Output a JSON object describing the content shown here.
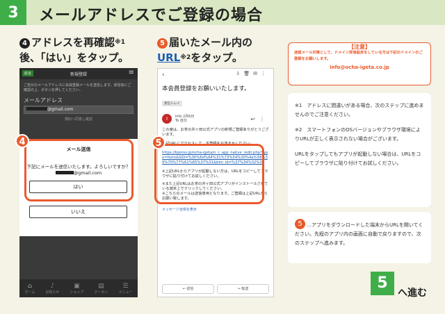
{
  "header": {
    "step": "3",
    "title": "メールアドレスでご登録の場合"
  },
  "step4": {
    "num": "4",
    "line1": "アドレスを再確認",
    "sup": "※1",
    "line2": "後、「はい」をタップ。"
  },
  "step5": {
    "num": "5",
    "line1": "届いたメール内の",
    "link": "URL",
    "sup": "※2",
    "line2": "をタップ。"
  },
  "phone1": {
    "back": "戻る",
    "title": "新規登録",
    "desc": "ご自分のメールアドレスに会員登録メールを送信します。受信後にご確認の上、ボタンを押してください。",
    "email_label": "メールアドレス",
    "email_value": "@gmail.com",
    "confirm": "規約へ同意し確認",
    "dialog": {
      "title": "メール送信",
      "msg1": "下記にメールを送信いたします。よろしいですか？",
      "msg2": "@gmail.com",
      "yes": "はい",
      "no": "いいえ"
    },
    "nav": [
      "ホーム",
      "お知らせ",
      "ショップ",
      "クーポン",
      "メニュー"
    ]
  },
  "phone2": {
    "subject": "本会員登録をお願いいたします。",
    "tag": "受信トレイ",
    "sender": "info",
    "date": "2月6日",
    "to": "To 自分",
    "body1": "この度は、お茶の井ヶ田公式アプリの新規ご登録ありがとうございます。",
    "body2": "下記URLにアクセスして、本登録をお済ませください。",
    "url": "https://bjenss.jp/ocha-igeta/n_c_app_native_redir.php?type=form&SID=%30%6d%64%31%73%54%30%4a%58%39%70%77%61%65%37%31&bim_id=%37%34%32%37",
    "body3": "※上記URLからアプリが起動しない方は、URLをコピーしてブラウザに貼り付けてお試しください。",
    "body4": "※また上記URLはお茶の井ヶ田公式アプリがインストールされている端末上でクリックしてください。",
    "body5": "※こちらのメールは送信専用となります。ご登録は上記URLからお願い致します。",
    "show_all": "メッセージ全体を表示",
    "reply": "返信",
    "forward": "転送"
  },
  "notice": {
    "title": "【注意】",
    "text": "迷惑メール対策として、ドメイン受信設定をしている方は下記のドメインのご登録をお願いします。",
    "mail": "info@ocha-igeta.co.jp"
  },
  "notes": {
    "n1": "※1　アドレスに間違いがある場合、次のステップに進めませんのでご注意ください。",
    "n2": "※2　スマートフォンのOSバージョンやブラウザ環境によりURLが正しく表示されない場合がございます。",
    "n3": "URLをタップしてもアプリが起動しない場合は、URLをコピーしてブラウザに貼り付けてお試しください。"
  },
  "note3": {
    "num": "5",
    "text": "…アプリをダウンロードした端末からURLを開いてください。先程のアプリ内の画面に自動で戻りますので、次のステップへ進みます。"
  },
  "next": {
    "num": "5",
    "label": "へ進む"
  }
}
